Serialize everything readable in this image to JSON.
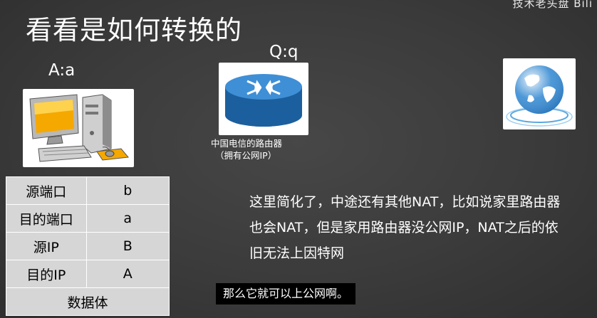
{
  "watermark": "技术老头盘 Bili",
  "title": "看看是如何转换的",
  "host_label": "A:a",
  "router_label": "Q:q",
  "router_caption": {
    "line1": "中国电信的路由器",
    "line2": "（拥有公网IP）"
  },
  "packet": {
    "rows": [
      {
        "field": "源端口",
        "value": "b"
      },
      {
        "field": "目的端口",
        "value": "a"
      },
      {
        "field": "源IP",
        "value": "B"
      },
      {
        "field": "目的IP",
        "value": "A"
      }
    ],
    "body_label": "数据体"
  },
  "note": "这里简化了，中途还有其他NAT，比如说家里路由器也会NAT，但是家用路由器没公网IP，NAT之后的依旧无法上因特网",
  "subtitle": "那么它就可以上公网啊。",
  "icons": [
    "computer-icon",
    "router-icon",
    "globe-icon"
  ]
}
